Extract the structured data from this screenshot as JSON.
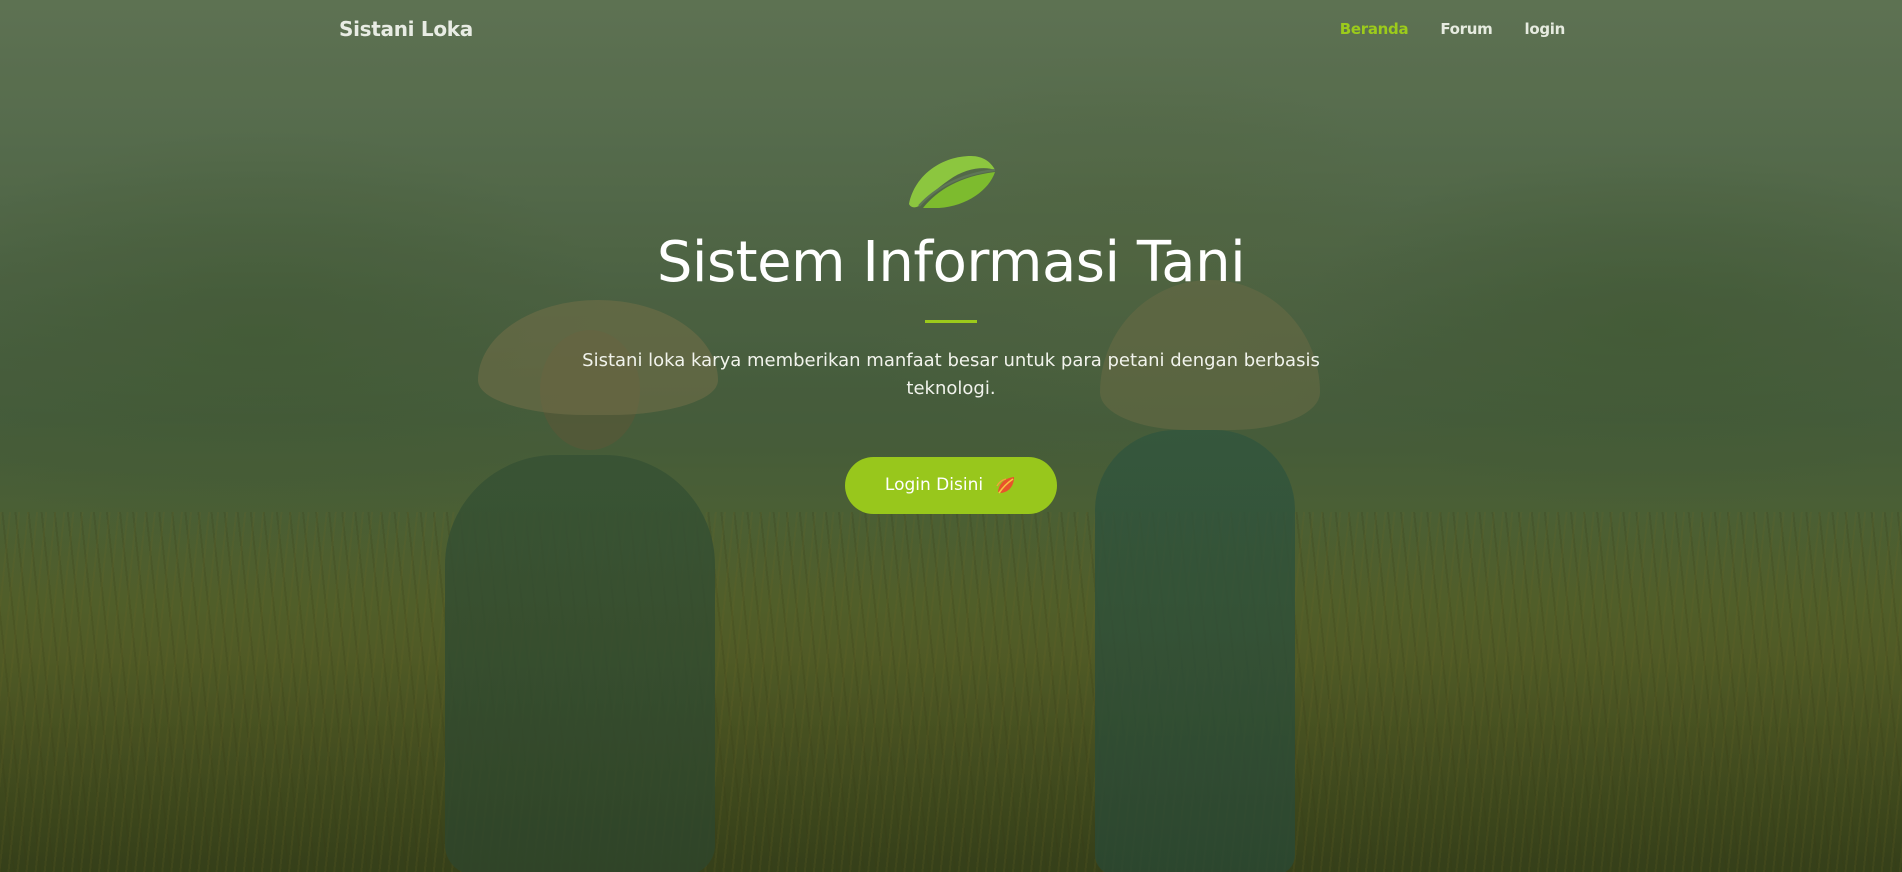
{
  "navbar": {
    "brand": "Sistani Loka",
    "links": [
      {
        "label": "Beranda",
        "active": true
      },
      {
        "label": "Forum",
        "active": false
      },
      {
        "label": "login",
        "active": false
      }
    ]
  },
  "hero": {
    "icon": "leaf-icon",
    "title": "Sistem Informasi Tani",
    "description": "Sistani loka karya memberikan manfaat besar untuk para petani dengan berbasis teknologi.",
    "button_label": "Login Disini",
    "button_icon": "leaf-icon"
  },
  "colors": {
    "accent": "#9ccb1b",
    "button": "#98c71c",
    "text": "#ffffff"
  }
}
